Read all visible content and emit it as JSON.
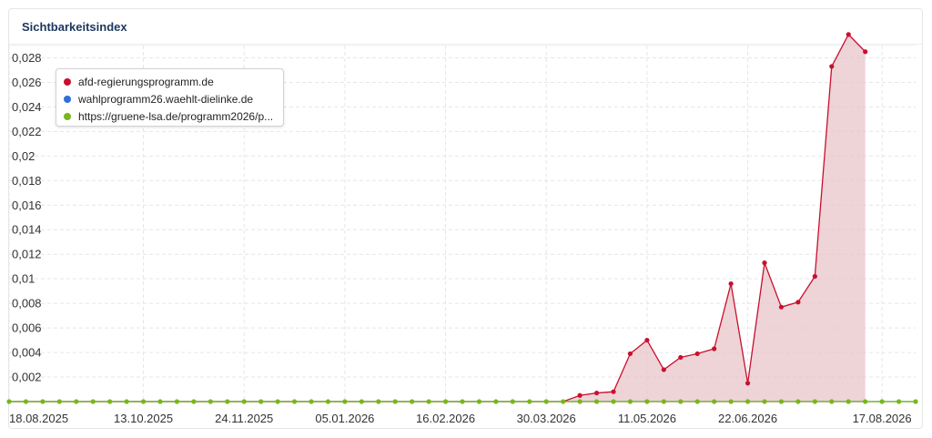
{
  "card": {
    "title": "Sichtbarkeitsindex"
  },
  "chart_data": {
    "type": "area",
    "title": "Sichtbarkeitsindex",
    "xlabel": "",
    "ylabel": "",
    "ylim": [
      0,
      0.029
    ],
    "y_ticks": [
      "0,002",
      "0,004",
      "0,006",
      "0,008",
      "0,01",
      "0,012",
      "0,014",
      "0,016",
      "0,018",
      "0,02",
      "0,022",
      "0,024",
      "0,026",
      "0,028"
    ],
    "y_tick_values": [
      0.002,
      0.004,
      0.006,
      0.008,
      0.01,
      0.012,
      0.014,
      0.016,
      0.018,
      0.02,
      0.022,
      0.024,
      0.026,
      0.028
    ],
    "x": [
      "18.08.2025",
      "25.08.2025",
      "01.09.2025",
      "08.09.2025",
      "15.09.2025",
      "22.09.2025",
      "29.09.2025",
      "06.10.2025",
      "13.10.2025",
      "20.10.2025",
      "27.10.2025",
      "03.11.2025",
      "10.11.2025",
      "17.11.2025",
      "24.11.2025",
      "01.12.2025",
      "08.12.2025",
      "15.12.2025",
      "22.12.2025",
      "29.12.2025",
      "05.01.2026",
      "12.01.2026",
      "19.01.2026",
      "26.01.2026",
      "02.02.2026",
      "09.02.2026",
      "16.02.2026",
      "23.02.2026",
      "02.03.2026",
      "09.03.2026",
      "16.03.2026",
      "23.03.2026",
      "30.03.2026",
      "06.04.2026",
      "13.04.2026",
      "20.04.2026",
      "27.04.2026",
      "04.05.2026",
      "11.05.2026",
      "18.05.2026",
      "25.05.2026",
      "01.06.2026",
      "08.06.2026",
      "15.06.2026",
      "22.06.2026",
      "29.06.2026",
      "06.07.2026",
      "13.07.2026",
      "20.07.2026",
      "27.07.2026",
      "03.08.2026",
      "10.08.2026",
      "17.08.2026",
      "24.08.2026",
      "31.08.2026"
    ],
    "x_ticks": [
      "18.08.2025",
      "13.10.2025",
      "24.11.2025",
      "05.01.2026",
      "16.02.2026",
      "30.03.2026",
      "11.05.2026",
      "22.06.2026",
      "17.08.2026"
    ],
    "grid": true,
    "legend_position": "top-left",
    "series": [
      {
        "name": "afd-regierungsprogramm.de",
        "color": "#c8102e",
        "fill": "#e8c4c9",
        "values": [
          0,
          0,
          0,
          0,
          0,
          0,
          0,
          0,
          0,
          0,
          0,
          0,
          0,
          0,
          0,
          0,
          0,
          0,
          0,
          0,
          0,
          0,
          0,
          0,
          0,
          0,
          0,
          0,
          0,
          0,
          0,
          0,
          0,
          0,
          0.0005,
          0.0007,
          0.0008,
          0.0039,
          0.005,
          0.0026,
          0.0036,
          0.0039,
          0.0043,
          0.0096,
          0.0015,
          0.0113,
          0.0077,
          0.0081,
          0.0102,
          0.0273,
          0.0299,
          0.0285
        ]
      },
      {
        "name": "wahlprogramm26.waehlt-dielinke.de",
        "color": "#2f6fd6",
        "values": [
          0,
          0,
          0,
          0,
          0,
          0,
          0,
          0,
          0,
          0,
          0,
          0,
          0,
          0,
          0,
          0,
          0,
          0,
          0,
          0,
          0,
          0,
          0,
          0,
          0,
          0,
          0,
          0,
          0,
          0,
          0,
          0,
          0,
          0,
          0,
          0,
          0,
          0,
          0,
          0,
          0,
          0,
          0,
          0,
          0,
          0,
          0,
          0,
          0,
          0,
          0,
          0,
          0,
          0,
          0
        ]
      },
      {
        "name": "https://gruene-lsa.de/programm2026/p...",
        "color": "#7ab51d",
        "values": [
          0,
          0,
          0,
          0,
          0,
          0,
          0,
          0,
          0,
          0,
          0,
          0,
          0,
          0,
          0,
          0,
          0,
          0,
          0,
          0,
          0,
          0,
          0,
          0,
          0,
          0,
          0,
          0,
          0,
          0,
          0,
          0,
          0,
          0,
          0,
          0,
          0,
          0,
          0,
          0,
          0,
          0,
          0,
          0,
          0,
          0,
          0,
          0,
          0,
          0,
          0,
          0,
          0,
          0,
          0
        ]
      }
    ]
  }
}
